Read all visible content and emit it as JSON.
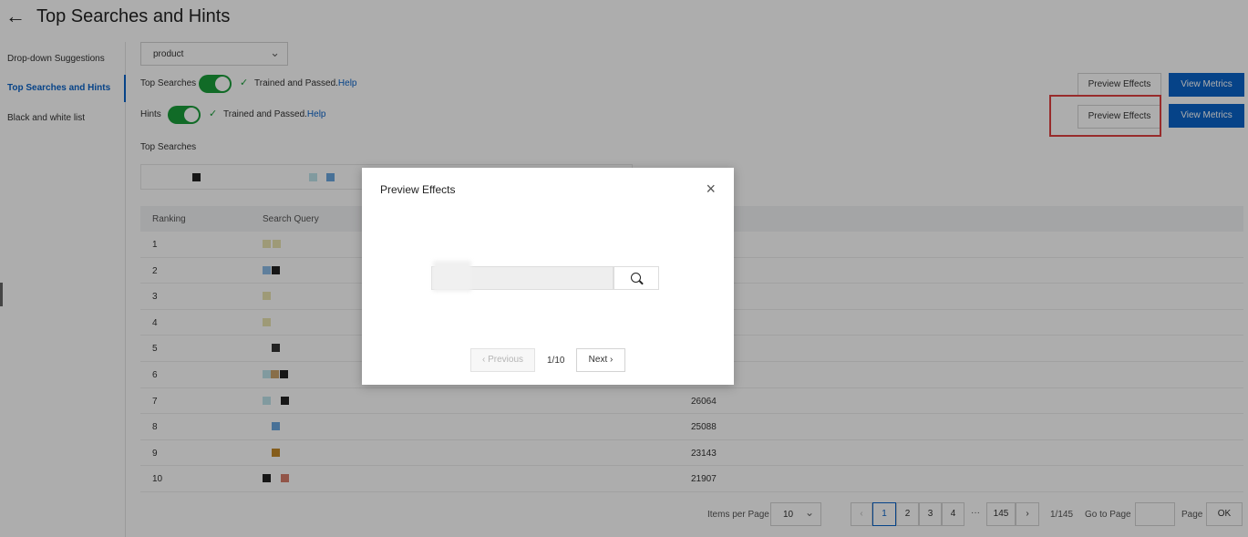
{
  "header": {
    "back_glyph": "←",
    "title": "Top Searches and Hints"
  },
  "sidebar": {
    "items": [
      {
        "label": "Drop-down Suggestions"
      },
      {
        "label": "Top Searches and Hints"
      },
      {
        "label": "Black and white list"
      }
    ]
  },
  "controls": {
    "select_value": "product",
    "top_searches": {
      "label": "Top Searches",
      "status": "Trained and Passed.",
      "help": "Help"
    },
    "hints": {
      "label": "Hints",
      "status": "Trained and Passed.",
      "help": "Help"
    },
    "preview_label": "Preview Effects",
    "metrics_label": "View Metrics"
  },
  "section": {
    "title": "Top Searches"
  },
  "table": {
    "headers": [
      "Ranking",
      "Search Query"
    ],
    "rows": [
      {
        "rank": "1",
        "count": ""
      },
      {
        "rank": "2",
        "count": ""
      },
      {
        "rank": "3",
        "count": ""
      },
      {
        "rank": "4",
        "count": ""
      },
      {
        "rank": "5",
        "count": ""
      },
      {
        "rank": "6",
        "count": ""
      },
      {
        "rank": "7",
        "count": "26064"
      },
      {
        "rank": "8",
        "count": "25088"
      },
      {
        "rank": "9",
        "count": "23143"
      },
      {
        "rank": "10",
        "count": "21907"
      }
    ]
  },
  "pagination": {
    "items_per_page_label": "Items per Page",
    "items_per_page": "10",
    "pages": [
      "1",
      "2",
      "3",
      "4"
    ],
    "ellipsis": "···",
    "last_page": "145",
    "page_count": "1/145",
    "goto_label": "Go to Page",
    "page_label": "Page",
    "ok_label": "OK"
  },
  "modal": {
    "title": "Preview Effects",
    "close": "×",
    "prev_label": "Previous",
    "page_indicator": "1/10",
    "next_label": "Next"
  },
  "colors": {
    "accent": "#0a63c9",
    "toggle_on": "#1a9e3a",
    "highlight": "#e04040"
  }
}
